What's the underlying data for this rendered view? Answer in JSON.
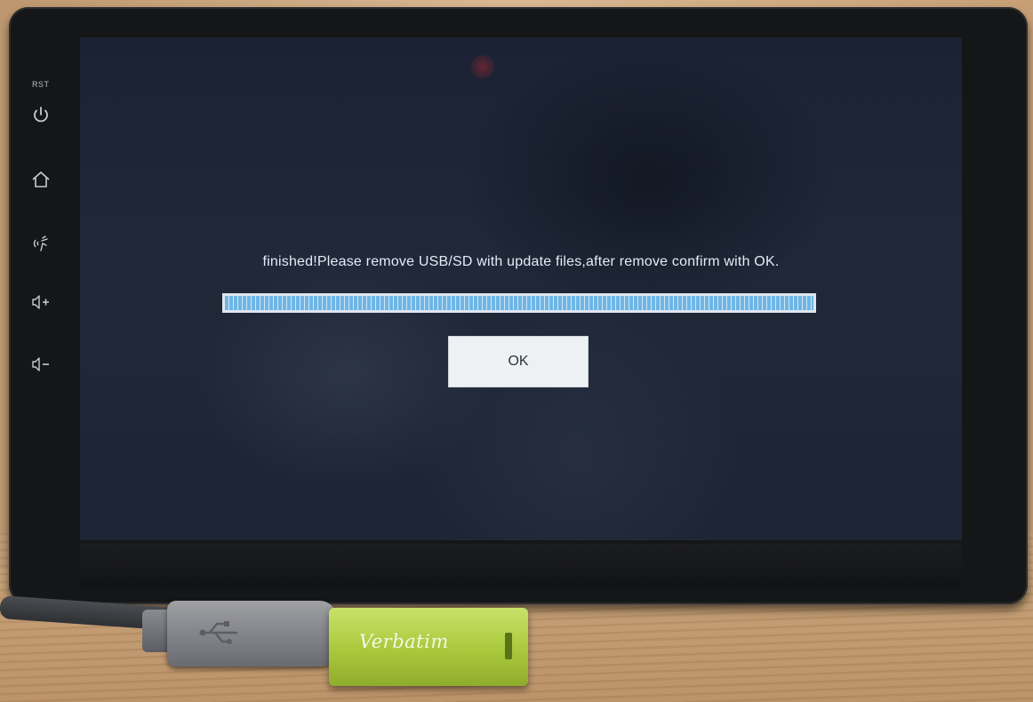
{
  "device": {
    "rst_label": "RST",
    "side_buttons": [
      "power-icon",
      "home-icon",
      "voice-icon",
      "volume-up-icon",
      "volume-down-icon"
    ]
  },
  "dialog": {
    "message": "finished!Please remove USB/SD with update files,after remove confirm with OK.",
    "progress_percent": 100,
    "ok_label": "OK"
  },
  "usb_drive": {
    "brand": "Verbatim"
  },
  "colors": {
    "screen_background": "#1e2637",
    "progress_fill": "#6fb6e6",
    "ok_button_background": "#eef1f4",
    "drive_body": "#a9c83c"
  }
}
